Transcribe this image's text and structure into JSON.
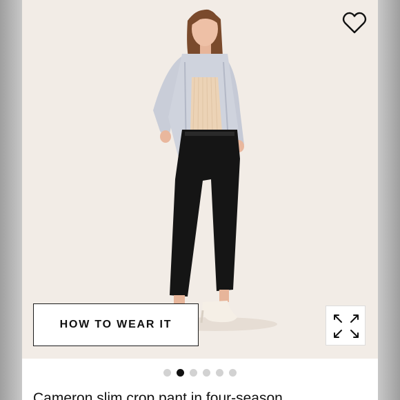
{
  "product": {
    "how_to_wear_label": "HOW TO WEAR IT",
    "title": "Cameron slim crop pant in four-season",
    "favorite_icon": "heart-icon",
    "expand_icon": "expand-icon"
  },
  "carousel": {
    "count": 6,
    "active_index": 1
  },
  "colors": {
    "hero_background": "#f2ece6",
    "active_dot": "#111111",
    "inactive_dot": "#d2d2d2"
  }
}
